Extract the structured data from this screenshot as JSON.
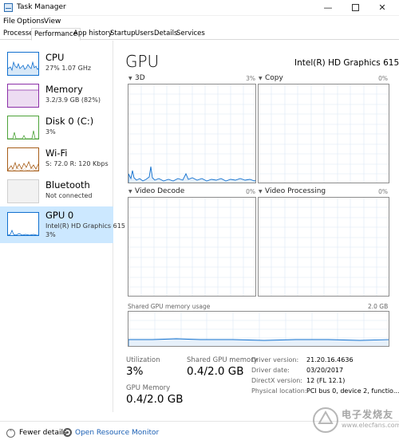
{
  "window": {
    "title": "Task Manager",
    "minimize": "—",
    "close": "✕"
  },
  "menu": [
    "File",
    "Options",
    "View"
  ],
  "tabs": [
    "Processes",
    "Performance",
    "App history",
    "Startup",
    "Users",
    "Details",
    "Services"
  ],
  "active_tab": "Performance",
  "sidebar": {
    "items": [
      {
        "name": "CPU",
        "sub": "27%  1.07 GHz",
        "color": "#1170cf"
      },
      {
        "name": "Memory",
        "sub": "3.2/3.9 GB (82%)",
        "color": "#8b2fa8"
      },
      {
        "name": "Disk 0 (C:)",
        "sub": "3%",
        "color": "#4da339"
      },
      {
        "name": "Wi-Fi",
        "sub": "S: 72.0  R: 120 Kbps",
        "color": "#a75d18"
      },
      {
        "name": "Bluetooth",
        "sub": "Not connected",
        "color": "#999999"
      },
      {
        "name": "GPU 0",
        "sub": "Intel(R) HD Graphics 615",
        "sub2": "3%",
        "color": "#1170cf"
      }
    ]
  },
  "main": {
    "title": "GPU",
    "model": "Intel(R) HD Graphics 615",
    "graphs": [
      {
        "label": "3D",
        "pct": "3%"
      },
      {
        "label": "Copy",
        "pct": "0%"
      },
      {
        "label": "Video Decode",
        "pct": "0%"
      },
      {
        "label": "Video Processing",
        "pct": "0%"
      }
    ],
    "shared_memory_label": "Shared GPU memory usage",
    "shared_memory_max": "2.0 GB",
    "stats": {
      "utilization_label": "Utilization",
      "utilization_value": "3%",
      "shared_label": "Shared GPU memory",
      "shared_value": "0.4/2.0 GB",
      "gpu_memory_label": "GPU Memory",
      "gpu_memory_value": "0.4/2.0 GB"
    },
    "details": [
      {
        "key": "Driver version:",
        "value": "21.20.16.4636"
      },
      {
        "key": "Driver date:",
        "value": "03/20/2017"
      },
      {
        "key": "DirectX version:",
        "value": "12 (FL 12.1)"
      },
      {
        "key": "Physical location:",
        "value": "PCI bus 0, device 2, functio..."
      }
    ]
  },
  "footer": {
    "fewer_details": "Fewer details",
    "open_resource_monitor": "Open Resource Monitor"
  },
  "watermark": {
    "main": "电子发烧友",
    "sub": "www.elecfans.com"
  }
}
